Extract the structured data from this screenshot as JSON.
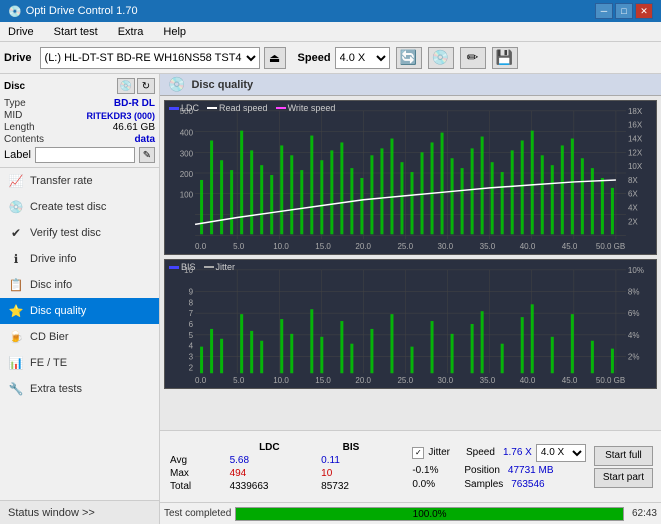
{
  "titlebar": {
    "title": "Opti Drive Control 1.70",
    "icon": "💿",
    "btn_min": "─",
    "btn_max": "□",
    "btn_close": "✕"
  },
  "menubar": {
    "items": [
      "Drive",
      "Start test",
      "Extra",
      "Help"
    ]
  },
  "drivebar": {
    "label": "Drive",
    "drive_value": "(L:)  HL-DT-ST BD-RE  WH16NS58 TST4",
    "speed_label": "Speed",
    "speed_value": "4.0 X"
  },
  "disc": {
    "type_label": "Type",
    "type_value": "BD-R DL",
    "mid_label": "MID",
    "mid_value": "RITEKDR3 (000)",
    "length_label": "Length",
    "length_value": "46.61 GB",
    "contents_label": "Contents",
    "contents_value": "data",
    "label_label": "Label"
  },
  "nav": {
    "items": [
      {
        "id": "transfer-rate",
        "label": "Transfer rate",
        "icon": "📈"
      },
      {
        "id": "create-test-disc",
        "label": "Create test disc",
        "icon": "💿"
      },
      {
        "id": "verify-test-disc",
        "label": "Verify test disc",
        "icon": "✔"
      },
      {
        "id": "drive-info",
        "label": "Drive info",
        "icon": "ℹ"
      },
      {
        "id": "disc-info",
        "label": "Disc info",
        "icon": "📋"
      },
      {
        "id": "disc-quality",
        "label": "Disc quality",
        "icon": "⭐",
        "active": true
      },
      {
        "id": "cd-bier",
        "label": "CD Bier",
        "icon": "🍺"
      },
      {
        "id": "fe-te",
        "label": "FE / TE",
        "icon": "📊"
      },
      {
        "id": "extra-tests",
        "label": "Extra tests",
        "icon": "🔧"
      }
    ],
    "status_window": "Status window >>"
  },
  "chart1": {
    "title": "Disc quality",
    "legend": [
      {
        "label": "LDC",
        "color": "#4444ff"
      },
      {
        "label": "Read speed",
        "color": "#ffffff"
      },
      {
        "label": "Write speed",
        "color": "#ff44ff"
      }
    ],
    "y_max": 500,
    "y_axis_right": [
      "18X",
      "16X",
      "14X",
      "12X",
      "10X",
      "8X",
      "6X",
      "4X",
      "2X"
    ],
    "x_axis": [
      "0.0",
      "5.0",
      "10.0",
      "15.0",
      "20.0",
      "25.0",
      "30.0",
      "35.0",
      "40.0",
      "45.0",
      "50.0 GB"
    ]
  },
  "chart2": {
    "legend": [
      {
        "label": "BIS",
        "color": "#4444ff"
      },
      {
        "label": "Jitter",
        "color": "#888888"
      }
    ],
    "y_max": 10,
    "y_axis_right": [
      "10%",
      "8%",
      "6%",
      "4%",
      "2%"
    ],
    "x_axis": [
      "0.0",
      "5.0",
      "10.0",
      "15.0",
      "20.0",
      "25.0",
      "30.0",
      "35.0",
      "40.0",
      "45.0",
      "50.0 GB"
    ]
  },
  "stats": {
    "columns": [
      "",
      "LDC",
      "BIS",
      "",
      "Jitter",
      "Speed",
      "1.76 X"
    ],
    "speed_select": "4.0 X",
    "rows": [
      {
        "label": "Avg",
        "ldc": "5.68",
        "bis": "0.11",
        "jitter": "-0.1%",
        "position_label": "Position",
        "position_val": "47731 MB"
      },
      {
        "label": "Max",
        "ldc": "494",
        "bis": "10",
        "jitter": "0.0%",
        "samples_label": "Samples",
        "samples_val": "763546"
      },
      {
        "label": "Total",
        "ldc": "4339663",
        "bis": "85732",
        "jitter": ""
      }
    ],
    "start_full": "Start full",
    "start_part": "Start part"
  },
  "bottombar": {
    "status": "Test completed",
    "progress": "100.0%",
    "progress_pct": 100,
    "time": "62:43"
  }
}
